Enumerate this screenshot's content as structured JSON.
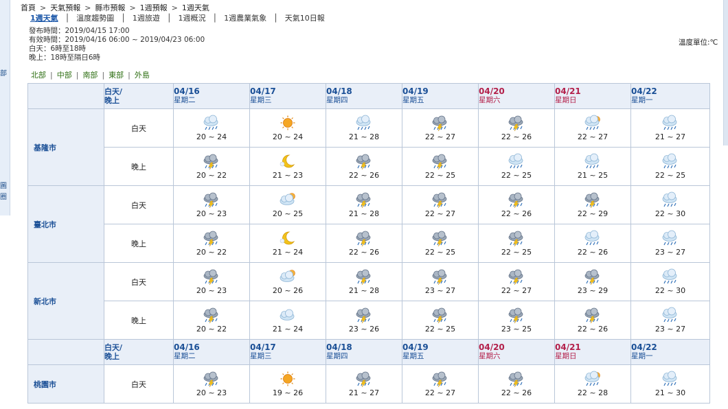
{
  "breadcrumb": [
    "首頁",
    "天氣預報",
    "縣市預報",
    "1週預報",
    "1週天氣"
  ],
  "tabs": [
    {
      "label": "1週天氣",
      "active": true
    },
    {
      "label": "溫度趨勢圖",
      "active": false
    },
    {
      "label": "1週旅遊",
      "active": false
    },
    {
      "label": "1週概況",
      "active": false
    },
    {
      "label": "1週農業氣象",
      "active": false
    },
    {
      "label": "天氣10日報",
      "active": false
    }
  ],
  "info": {
    "issue": "發布時間：2019/04/15 17:00",
    "valid": "有效時間：2019/04/16 06:00 ~ 2019/04/23 06:00",
    "day_def": "白天：6時至18時",
    "night_def": "晚上：18時至隔日6時"
  },
  "unit_label": "溫度單位:℃",
  "regions": [
    "北部",
    "中部",
    "南部",
    "東部",
    "外島"
  ],
  "header": {
    "day_night_1": "白天/",
    "day_night_2": "晚上",
    "days": [
      {
        "date": "04/16",
        "weekday": "星期二",
        "weekend": false
      },
      {
        "date": "04/17",
        "weekday": "星期三",
        "weekend": false
      },
      {
        "date": "04/18",
        "weekday": "星期四",
        "weekend": false
      },
      {
        "date": "04/19",
        "weekday": "星期五",
        "weekend": false
      },
      {
        "date": "04/20",
        "weekday": "星期六",
        "weekend": true
      },
      {
        "date": "04/21",
        "weekday": "星期日",
        "weekend": true
      },
      {
        "date": "04/22",
        "weekday": "星期一",
        "weekend": false
      }
    ]
  },
  "period_labels": {
    "day": "白天",
    "night": "晚上"
  },
  "cities": [
    {
      "name": "基隆市",
      "day": [
        {
          "icon": "rain-cloud-icon",
          "temp": "20 ~ 24"
        },
        {
          "icon": "sun-icon",
          "temp": "20 ~ 24"
        },
        {
          "icon": "rain-cloud-icon",
          "temp": "21 ~ 28"
        },
        {
          "icon": "thunder-rain-icon",
          "temp": "22 ~ 27"
        },
        {
          "icon": "thunder-rain-icon",
          "temp": "22 ~ 26"
        },
        {
          "icon": "sun-rain-icon",
          "temp": "22 ~ 27"
        },
        {
          "icon": "rain-cloud-icon",
          "temp": "21 ~ 27"
        }
      ],
      "night": [
        {
          "icon": "thunder-rain-icon",
          "temp": "20 ~ 22"
        },
        {
          "icon": "moon-icon",
          "temp": "21 ~ 23"
        },
        {
          "icon": "thunder-rain-icon",
          "temp": "22 ~ 26"
        },
        {
          "icon": "thunder-rain-icon",
          "temp": "22 ~ 25"
        },
        {
          "icon": "rain-cloud-icon",
          "temp": "22 ~ 25"
        },
        {
          "icon": "rain-cloud-icon",
          "temp": "21 ~ 25"
        },
        {
          "icon": "rain-cloud-icon",
          "temp": "22 ~ 25"
        }
      ]
    },
    {
      "name": "臺北市",
      "day": [
        {
          "icon": "thunder-rain-icon",
          "temp": "20 ~ 23"
        },
        {
          "icon": "partly-cloudy-icon",
          "temp": "20 ~ 25"
        },
        {
          "icon": "thunder-rain-icon",
          "temp": "21 ~ 28"
        },
        {
          "icon": "thunder-rain-icon",
          "temp": "22 ~ 27"
        },
        {
          "icon": "thunder-rain-icon",
          "temp": "22 ~ 26"
        },
        {
          "icon": "thunder-rain-icon",
          "temp": "22 ~ 29"
        },
        {
          "icon": "rain-cloud-icon",
          "temp": "22 ~ 30"
        }
      ],
      "night": [
        {
          "icon": "thunder-rain-icon",
          "temp": "20 ~ 22"
        },
        {
          "icon": "moon-icon",
          "temp": "21 ~ 24"
        },
        {
          "icon": "thunder-rain-icon",
          "temp": "22 ~ 26"
        },
        {
          "icon": "thunder-rain-icon",
          "temp": "22 ~ 25"
        },
        {
          "icon": "thunder-rain-icon",
          "temp": "22 ~ 25"
        },
        {
          "icon": "rain-cloud-icon",
          "temp": "22 ~ 26"
        },
        {
          "icon": "rain-cloud-icon",
          "temp": "23 ~ 27"
        }
      ]
    },
    {
      "name": "新北市",
      "day": [
        {
          "icon": "thunder-rain-icon",
          "temp": "20 ~ 23"
        },
        {
          "icon": "partly-cloudy-icon",
          "temp": "20 ~ 26"
        },
        {
          "icon": "thunder-rain-icon",
          "temp": "21 ~ 28"
        },
        {
          "icon": "thunder-rain-icon",
          "temp": "23 ~ 27"
        },
        {
          "icon": "thunder-rain-icon",
          "temp": "22 ~ 27"
        },
        {
          "icon": "thunder-rain-icon",
          "temp": "23 ~ 29"
        },
        {
          "icon": "rain-cloud-icon",
          "temp": "22 ~ 30"
        }
      ],
      "night": [
        {
          "icon": "thunder-rain-icon",
          "temp": "20 ~ 22"
        },
        {
          "icon": "cloud-icon",
          "temp": "21 ~ 24"
        },
        {
          "icon": "thunder-rain-icon",
          "temp": "23 ~ 26"
        },
        {
          "icon": "thunder-rain-icon",
          "temp": "22 ~ 25"
        },
        {
          "icon": "thunder-rain-icon",
          "temp": "23 ~ 25"
        },
        {
          "icon": "thunder-rain-icon",
          "temp": "22 ~ 26"
        },
        {
          "icon": "rain-cloud-icon",
          "temp": "23 ~ 27"
        }
      ]
    },
    {
      "name": "桃園市",
      "day": [
        {
          "icon": "thunder-rain-icon",
          "temp": "20 ~ 23"
        },
        {
          "icon": "sun-icon",
          "temp": "19 ~ 26"
        },
        {
          "icon": "thunder-rain-icon",
          "temp": "21 ~ 27"
        },
        {
          "icon": "thunder-rain-icon",
          "temp": "22 ~ 27"
        },
        {
          "icon": "thunder-rain-icon",
          "temp": "22 ~ 26"
        },
        {
          "icon": "sun-rain-icon",
          "temp": "22 ~ 28"
        },
        {
          "icon": "rain-cloud-icon",
          "temp": "21 ~ 30"
        }
      ]
    }
  ],
  "side_fragments": [
    "部",
    "圖",
    "圈"
  ],
  "colors": {
    "link_blue": "#1a56a8",
    "header_bg": "#e9eff8",
    "weekend_red": "#b3204a",
    "region_green": "#2d6e12"
  }
}
